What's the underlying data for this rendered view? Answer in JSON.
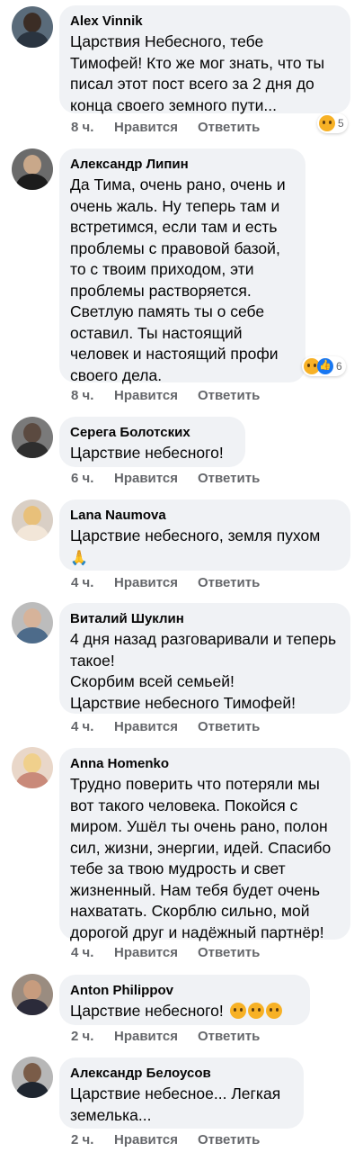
{
  "comments": [
    {
      "author": "Alex Vinnik",
      "text": "Царствия Небесного, тебе Тимофей! Кто же мог знать, что ты писал этот пост всего за 2 дня до конца своего земного пути...",
      "time": "8 ч.",
      "like": "Нравится",
      "reply": "Ответить",
      "reactions_count": "5"
    },
    {
      "author": "Александр Липин",
      "text": "Да Тима, очень рано, очень и очень жаль. Ну теперь там и встретимся, если там и есть проблемы с правовой базой, то с твоим приходом, эти проблемы растворяется. Светлую память ты о себе оставил. Ты настоящий человек и настоящий профи своего дела.",
      "time": "8 ч.",
      "like": "Нравится",
      "reply": "Ответить",
      "reactions_count": "6"
    },
    {
      "author": "Серега Болотских",
      "text": "Царствие небесного!",
      "time": "6 ч.",
      "like": "Нравится",
      "reply": "Ответить"
    },
    {
      "author": "Lana Naumova",
      "text": "Царствие небесного, земля пухом",
      "emoji": "🙏",
      "time": "4 ч.",
      "like": "Нравится",
      "reply": "Ответить"
    },
    {
      "author": "Виталий Шуклин",
      "text": "4 дня назад разговаривали и теперь такое!\nСкорбим всей семьей!\nЦарствие небесного Тимофей!",
      "time": "4 ч.",
      "like": "Нравится",
      "reply": "Ответить"
    },
    {
      "author": "Anna Homenko",
      "text": "Трудно поверить что потеряли мы вот такого человека. Покойся с миром. Ушёл ты очень рано, полон сил, жизни, энергии, идей. Спасибо тебе за твою мудрость и свет жизненный. Нам тебя будет очень нахватать. Скорблю сильно, мой дорогой друг и надёжный партнёр!",
      "time": "4 ч.",
      "like": "Нравится",
      "reply": "Ответить"
    },
    {
      "author": "Anton Philippov",
      "text": "Царствие небесного!",
      "time": "2 ч.",
      "like": "Нравится",
      "reply": "Ответить"
    },
    {
      "author": "Александр Белоусов",
      "text": "Царствие небесное... Легкая земелька...",
      "time": "2 ч.",
      "like": "Нравится",
      "reply": "Ответить"
    }
  ],
  "colors": {
    "bubble": "#f0f2f5",
    "meta": "#65676b",
    "text": "#050505",
    "like_blue": "#1877f2",
    "sad_yellow": "#f7b125"
  },
  "icons": [
    "sad-emoji-icon",
    "like-reaction-icon",
    "pray-emoji-icon",
    "avatar"
  ]
}
